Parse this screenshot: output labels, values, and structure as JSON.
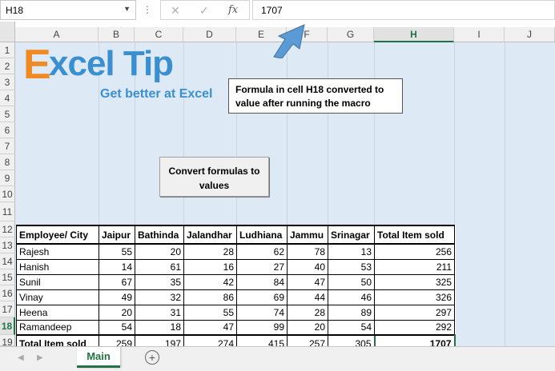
{
  "formula_bar": {
    "name_box": "H18",
    "formula": "1707",
    "fx_label": "fx"
  },
  "columns": [
    "A",
    "B",
    "C",
    "D",
    "E",
    "F",
    "G",
    "H",
    "I",
    "J"
  ],
  "rows": [
    "1",
    "2",
    "3",
    "4",
    "5",
    "6",
    "7",
    "8",
    "9",
    "10",
    "11",
    "12",
    "13",
    "14",
    "15",
    "16",
    "17",
    "18",
    "19"
  ],
  "logo": {
    "x_letter": "E",
    "brand": "xcel Tip",
    "tagline": "Get better at Excel"
  },
  "callout": {
    "line1": "Formula in cell H18 converted to",
    "line2": "value after running the macro"
  },
  "macro_button": {
    "line1": "Convert formulas to",
    "line2": "values"
  },
  "table": {
    "headers": [
      "Employee/ City",
      "Jaipur",
      "Bathinda",
      "Jalandhar",
      "Ludhiana",
      "Jammu",
      "Srinagar",
      "Total Item sold"
    ],
    "rows": [
      [
        "Rajesh",
        "55",
        "20",
        "28",
        "62",
        "78",
        "13",
        "256"
      ],
      [
        "Hanish",
        "14",
        "61",
        "16",
        "27",
        "40",
        "53",
        "211"
      ],
      [
        "Sunil",
        "67",
        "35",
        "42",
        "84",
        "47",
        "50",
        "325"
      ],
      [
        "Vinay",
        "49",
        "32",
        "86",
        "69",
        "44",
        "46",
        "326"
      ],
      [
        "Heena",
        "20",
        "31",
        "55",
        "74",
        "28",
        "89",
        "297"
      ],
      [
        "Ramandeep",
        "54",
        "18",
        "47",
        "99",
        "20",
        "54",
        "292"
      ]
    ],
    "total": [
      "Total Item sold",
      "259",
      "197",
      "274",
      "415",
      "257",
      "305",
      "1707"
    ]
  },
  "tabs": {
    "active": "Main",
    "add_icon": "plus-circle-icon"
  },
  "colors": {
    "excel_green": "#217346",
    "sheet_fill": "#dde9f5",
    "logo_blue": "#3a8fd0",
    "logo_orange": "#f08a24"
  }
}
